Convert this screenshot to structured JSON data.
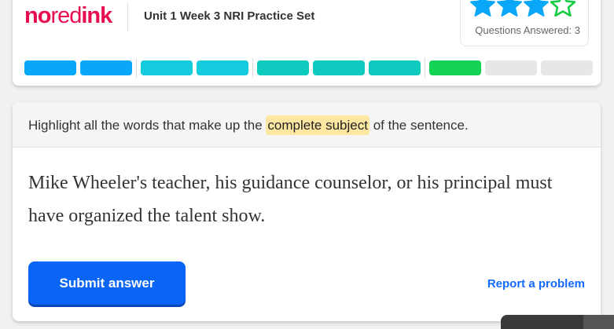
{
  "header": {
    "logo": {
      "part1": "no",
      "part2": "red",
      "part3": "ink"
    },
    "set_title": "Unit 1 Week 3 NRI Practice Set",
    "stars": {
      "earned": 3,
      "total": 4,
      "color": "#09a7f8",
      "unearned_color": "#12cb41"
    },
    "questions_answered_label": "Questions Answered: 3"
  },
  "progress_segments": [
    {
      "color": "#09a7f8"
    },
    {
      "color": "#09a7f8"
    },
    {
      "color": "#14ccde"
    },
    {
      "color": "#14ccde"
    },
    {
      "color": "#0fcbbf"
    },
    {
      "color": "#0fcbbf"
    },
    {
      "color": "#0fcbbf"
    },
    {
      "color": "#12d354"
    },
    {
      "color": "#e7e7e7"
    },
    {
      "color": "#e7e7e7"
    }
  ],
  "question": {
    "prompt_before": "Highlight all the words that make up the ",
    "prompt_highlight": "complete subject",
    "prompt_after": " of the sentence.",
    "sentence": "Mike Wheeler's teacher, his guidance counselor, or his principal must have organized the talent show."
  },
  "actions": {
    "submit_label": "Submit answer",
    "report_label": "Report a problem"
  }
}
